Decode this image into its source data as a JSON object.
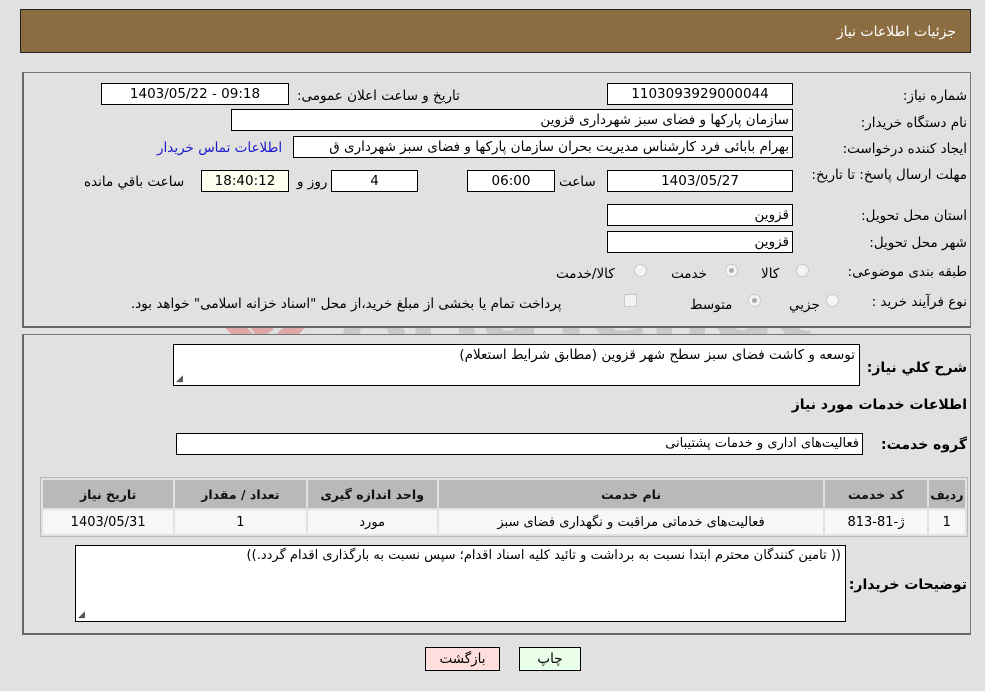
{
  "header": {
    "title": "جزئیات اطلاعات نیاز"
  },
  "form": {
    "need_number": {
      "label": "شماره نیاز:",
      "value": "1103093929000044"
    },
    "announce_datetime": {
      "label": "تاریخ و ساعت اعلان عمومی:",
      "value": "1403/05/22 - 09:18"
    },
    "buyer_org": {
      "label": "نام دستگاه خریدار:",
      "value": "سازمان پارکها و فضای سبز شهرداری قزوین"
    },
    "requester": {
      "label": "ایجاد کننده درخواست:",
      "value": "بهرام بابائی فرد کارشناس مدیریت بحران سازمان پارکها و فضای سبز شهرداری ق"
    },
    "buyer_contact_link": "اطلاعات تماس خریدار",
    "deadline": {
      "label": "مهلت ارسال پاسخ: تا تاریخ:",
      "date": "1403/05/27",
      "time_label": "ساعت",
      "time": "06:00",
      "days": "4",
      "days_label": "روز و",
      "remaining": "18:40:12",
      "remaining_label": "ساعت باقي مانده"
    },
    "province": {
      "label": "استان محل تحویل:",
      "value": "قزوین"
    },
    "city": {
      "label": "شهر محل تحویل:",
      "value": "قزوین"
    },
    "category": {
      "label": "طبقه بندی موضوعی:",
      "options": [
        "کالا",
        "خدمت",
        "کالا/خدمت"
      ],
      "selected": "خدمت"
    },
    "purchase_type": {
      "label": "نوع فرآیند خرید :",
      "options": [
        "جزيي",
        "متوسط"
      ],
      "selected": "متوسط",
      "payment_note": "پرداخت تمام یا بخشی از مبلغ خرید،از محل \"اسناد خزانه اسلامی\" خواهد بود."
    }
  },
  "description": {
    "label": "شرح کلي نیاز:",
    "value": "توسعه و کاشت فضای سبز سطح شهر قزوین (مطابق شرایط استعلام)"
  },
  "services_section": {
    "title": "اطلاعات خدمات مورد نیاز",
    "group_label": "گروه خدمت:",
    "group_value": "فعالیت‌های اداری و خدمات پشتیبانی"
  },
  "table": {
    "headers": [
      "ردیف",
      "کد خدمت",
      "نام خدمت",
      "واحد اندازه گیری",
      "تعداد / مقدار",
      "تاریخ نیاز"
    ],
    "rows": [
      [
        "1",
        "ژ-81-813",
        "فعالیت‌های خدماتی مراقبت و نگهداری فضای سبز",
        "مورد",
        "1",
        "1403/05/31"
      ]
    ]
  },
  "buyer_notes": {
    "label": "توضیحات خریدار:",
    "value": "(( تامین کنندگان محترم ابتدا نسبت به برداشت و تائید کلیه اسناد اقدام؛ سپس نسبت به بارگذاری اقدام گردد.))"
  },
  "buttons": {
    "print": "چاپ",
    "back": "بازگشت"
  },
  "watermark": {
    "text": "AriaTender.neT"
  },
  "colors": {
    "header_bg": "#8c6d42",
    "link": "#1a1acc",
    "back_btn": "#ffdede",
    "print_btn": "#eaffea",
    "table_header": "#b9b9b9"
  }
}
